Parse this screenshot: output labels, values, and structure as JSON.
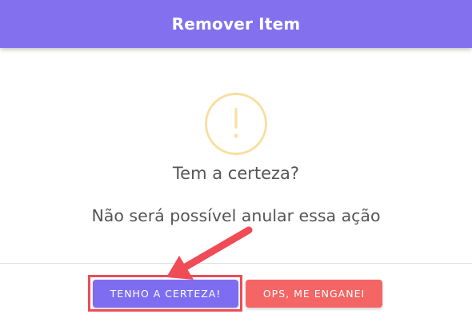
{
  "dialog": {
    "title": "Remover Item",
    "question": "Tem a certeza?",
    "message": "Não será possível anular essa ação",
    "icon": "warning-exclamation-icon",
    "confirm_label": "TENHO A CERTEZA!",
    "cancel_label": "OPS, ME ENGANEI"
  },
  "colors": {
    "header": "#8370ef",
    "confirm": "#7f6df1",
    "cancel": "#f46565",
    "warning": "#f9dfa0",
    "annotation": "#ef4c56"
  },
  "annotation": {
    "type": "arrow-and-box",
    "target": "confirm-button"
  }
}
